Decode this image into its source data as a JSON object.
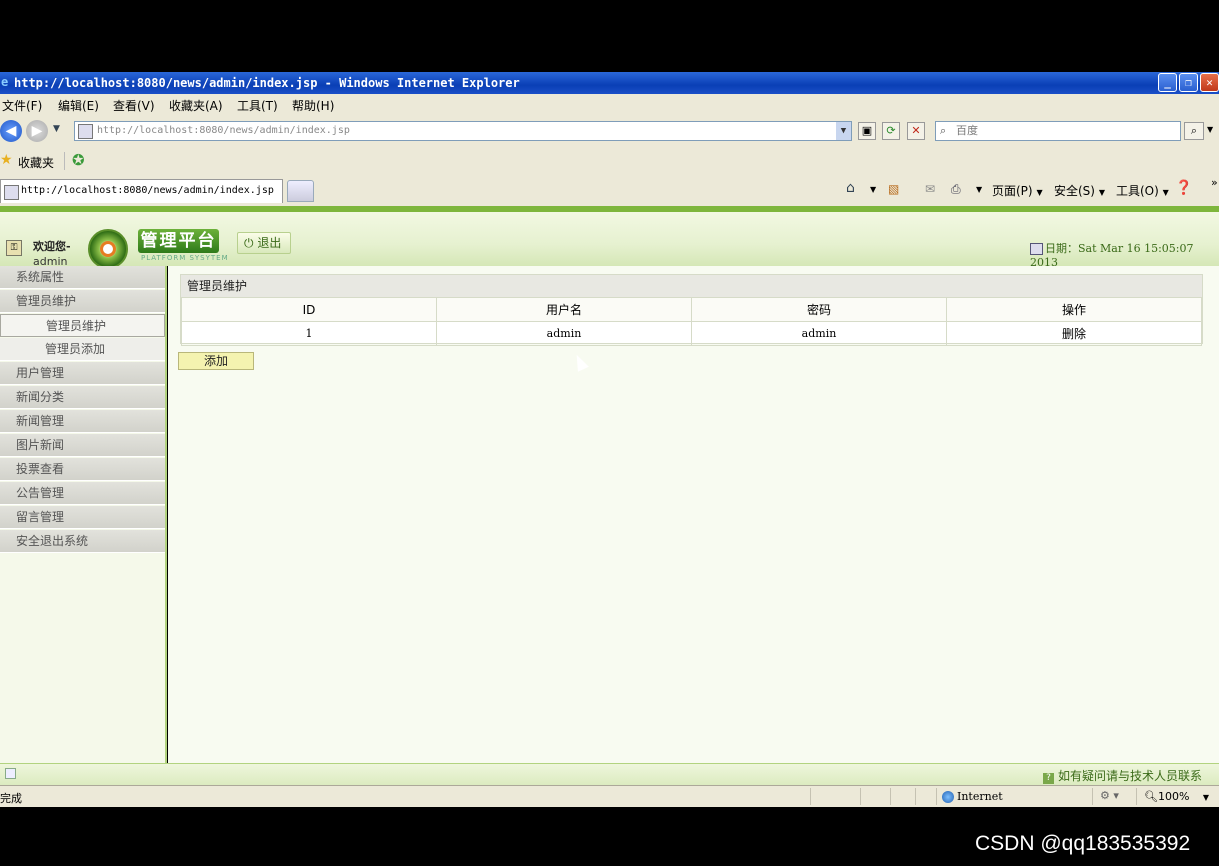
{
  "window": {
    "title": "http://localhost:8080/news/admin/index.jsp - Windows Internet Explorer",
    "minimize": "_",
    "maximize": "❐",
    "close": "✕"
  },
  "menubar": [
    "文件(F)",
    "编辑(E)",
    "查看(V)",
    "收藏夹(A)",
    "工具(T)",
    "帮助(H)"
  ],
  "address": {
    "url": "http://localhost:8080/news/admin/index.jsp",
    "search_placeholder": "百度"
  },
  "favorites": {
    "label": "收藏夹"
  },
  "tab": {
    "title": "http://localhost:8080/news/admin/index.jsp"
  },
  "commandbar": {
    "page": "页面(P)",
    "safety": "安全(S)",
    "tools": "工具(O)"
  },
  "app": {
    "welcome": "欢迎您-",
    "user": "admin",
    "platform_title": "管理平台",
    "platform_sub": "PLATFORM SYSYTEM",
    "logout": "退出",
    "date_label": "日期：",
    "date_value": "Sat Mar 16 15:05:07 2013"
  },
  "sidebar": {
    "items": [
      "系统属性",
      "管理员维护",
      "用户管理",
      "新闻分类",
      "新闻管理",
      "图片新闻",
      "投票查看",
      "公告管理",
      "留言管理",
      "安全退出系统"
    ],
    "subitems": [
      "管理员维护",
      "管理员添加"
    ]
  },
  "main": {
    "panel_title": "管理员维护",
    "columns": [
      "ID",
      "用户名",
      "密码",
      "操作"
    ],
    "rows": [
      {
        "id": "1",
        "username": "admin",
        "password": "admin",
        "action": "删除"
      }
    ],
    "add_button": "添加"
  },
  "footer": {
    "help_text": "如有疑问请与技术人员联系"
  },
  "statusbar": {
    "status": "完成",
    "zone": "Internet",
    "zoom": "100%"
  },
  "watermark": "CSDN @qq183535392"
}
